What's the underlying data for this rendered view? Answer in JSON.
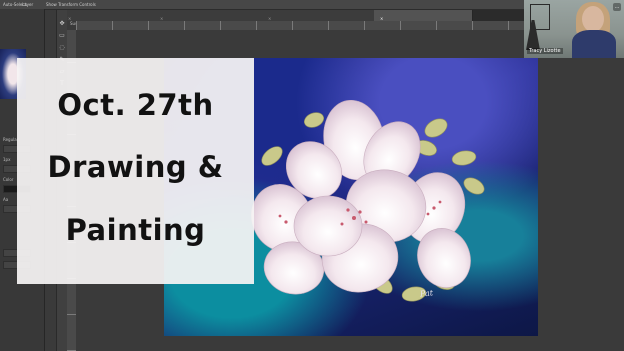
{
  "options_bar": {
    "item_1": "Auto-Select:",
    "item_2": "Layer",
    "item_3": "Show Transform Controls"
  },
  "tabs": [
    {
      "label": "Susanna.jpeg @ 152% (RGB/8*)",
      "active": false
    },
    {
      "label": "Dog.jpeg @ 525% (Layer 1, RGB/8*)",
      "active": false
    },
    {
      "label": "Dog Ref.jpeg @ 333% (Layer 1, RGB/8*)",
      "active": false
    },
    {
      "label": "Pat Flower.jpeg @ 134% (RGB/8*)",
      "active": true
    }
  ],
  "left_panel": {
    "labels": [
      "Regular",
      "1px",
      "Color",
      "Aa"
    ]
  },
  "title_card": {
    "line_1": "Oct. 27th",
    "line_2": "Drawing &",
    "line_3": "Painting"
  },
  "painting": {
    "signature": "Pat"
  },
  "webcam": {
    "name": "Tracy Lizotte",
    "menu_icon": "…"
  },
  "colors": {
    "background": "#3a3a3a",
    "title_card": "#f6f4f4",
    "painting_blue": "#1b1f6a",
    "painting_teal": "#0c8ea0",
    "petal": "#f4e8ee",
    "leaf": "#c9c98a"
  },
  "icons": [
    "move-icon",
    "marquee-icon",
    "lasso-icon",
    "brush-icon",
    "eraser-icon",
    "text-icon",
    "zoom-icon",
    "close-tab-icon"
  ]
}
